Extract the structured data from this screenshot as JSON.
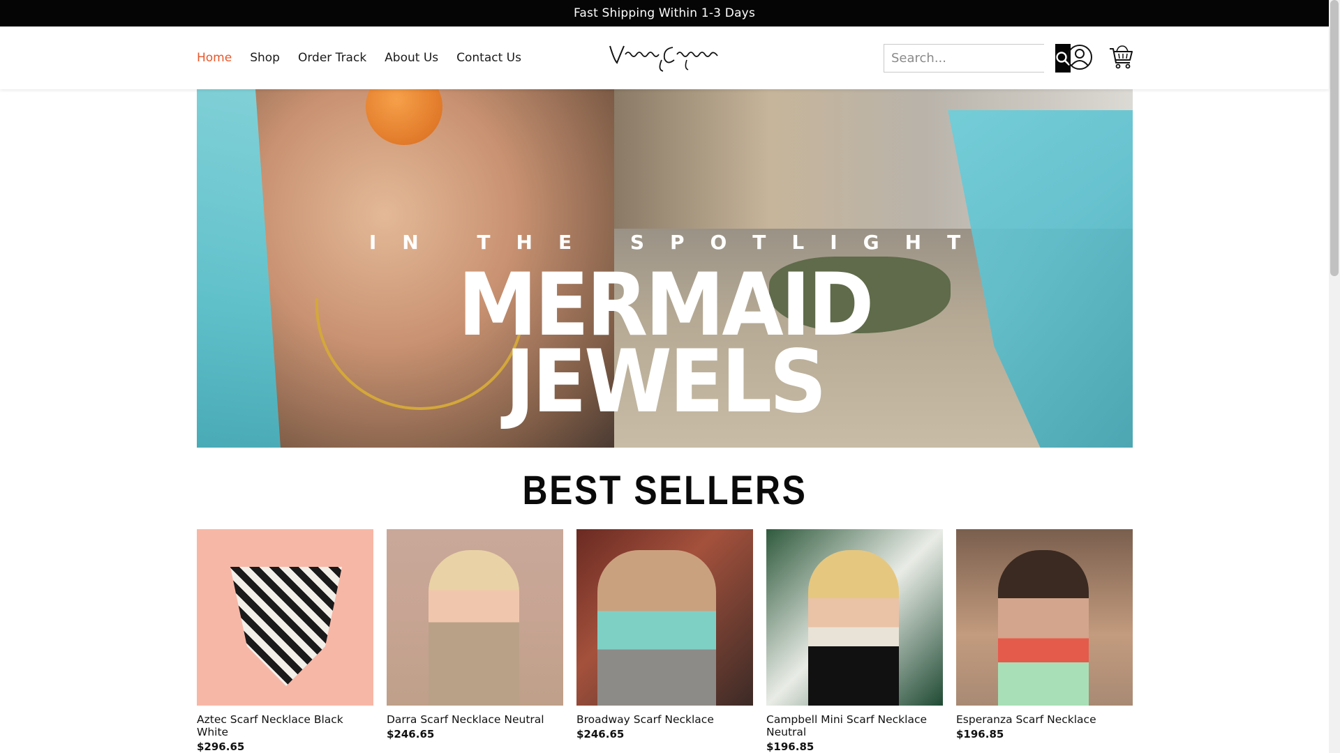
{
  "announcement": "Fast Shipping Within 1-3 Days",
  "nav": {
    "items": [
      {
        "label": "Home",
        "active": true
      },
      {
        "label": "Shop"
      },
      {
        "label": "Order Track"
      },
      {
        "label": "About Us"
      },
      {
        "label": "Contact Us"
      }
    ]
  },
  "logo": "Mignonne Gavigan",
  "search": {
    "placeholder": "Search..."
  },
  "hero": {
    "kicker": "IN THE SPOTLIGHT",
    "title_line1": "MERMAID",
    "title_line2": "JEWELS"
  },
  "best_sellers": {
    "title": "BEST SELLERS",
    "products": [
      {
        "name": "Aztec Scarf Necklace Black White",
        "price": "$296.65"
      },
      {
        "name": "Darra Scarf Necklace Neutral",
        "price": "$246.65"
      },
      {
        "name": "Broadway Scarf Necklace",
        "price": "$246.65"
      },
      {
        "name": "Campbell Mini Scarf Necklace Neutral",
        "price": "$196.85"
      },
      {
        "name": "Esperanza Scarf Necklace",
        "price": "$196.85"
      }
    ]
  },
  "colors": {
    "accent": "#e8572a",
    "announcement_bg": "#050505",
    "search_button_bg": "#050505"
  },
  "icons": {
    "search": "search-icon",
    "account": "account-icon",
    "cart": "cart-icon"
  }
}
